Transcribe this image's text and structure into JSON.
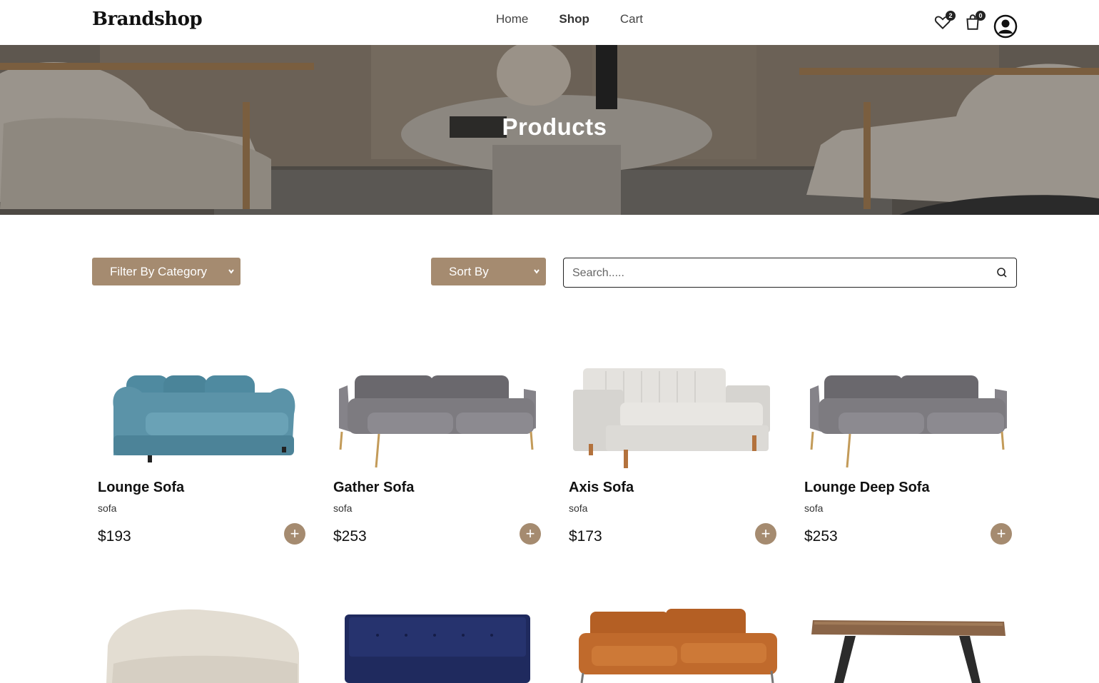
{
  "brand": "Brandshop",
  "nav": [
    {
      "label": "Home",
      "active": false
    },
    {
      "label": "Shop",
      "active": true
    },
    {
      "label": "Cart",
      "active": false
    }
  ],
  "header_icons": {
    "wishlist_count": "2",
    "cart_count": "0"
  },
  "hero": {
    "title": "Products"
  },
  "filters": {
    "category_label": "Filter By Category",
    "sort_label": "Sort By"
  },
  "search": {
    "placeholder": "Search....."
  },
  "products": [
    {
      "name": "Lounge Sofa",
      "category": "sofa",
      "price": "$193",
      "color": "#5b93a8",
      "icon": "sofa-teal"
    },
    {
      "name": "Gather Sofa",
      "category": "sofa",
      "price": "$253",
      "color": "#7d7b80",
      "icon": "sofa-grey"
    },
    {
      "name": "Axis Sofa",
      "category": "sofa",
      "price": "$173",
      "color": "#dcdad6",
      "icon": "sofa-white"
    },
    {
      "name": "Lounge Deep Sofa",
      "category": "sofa",
      "price": "$253",
      "color": "#7d7b80",
      "icon": "sofa-grey"
    }
  ],
  "products_row2": [
    {
      "icon": "curved-sofa",
      "color": "#e3ddd2"
    },
    {
      "icon": "navy-sofa",
      "color": "#1f2a5e"
    },
    {
      "icon": "leather-sofa",
      "color": "#c06a2c"
    },
    {
      "icon": "wooden-table",
      "color": "#8a6548"
    }
  ]
}
